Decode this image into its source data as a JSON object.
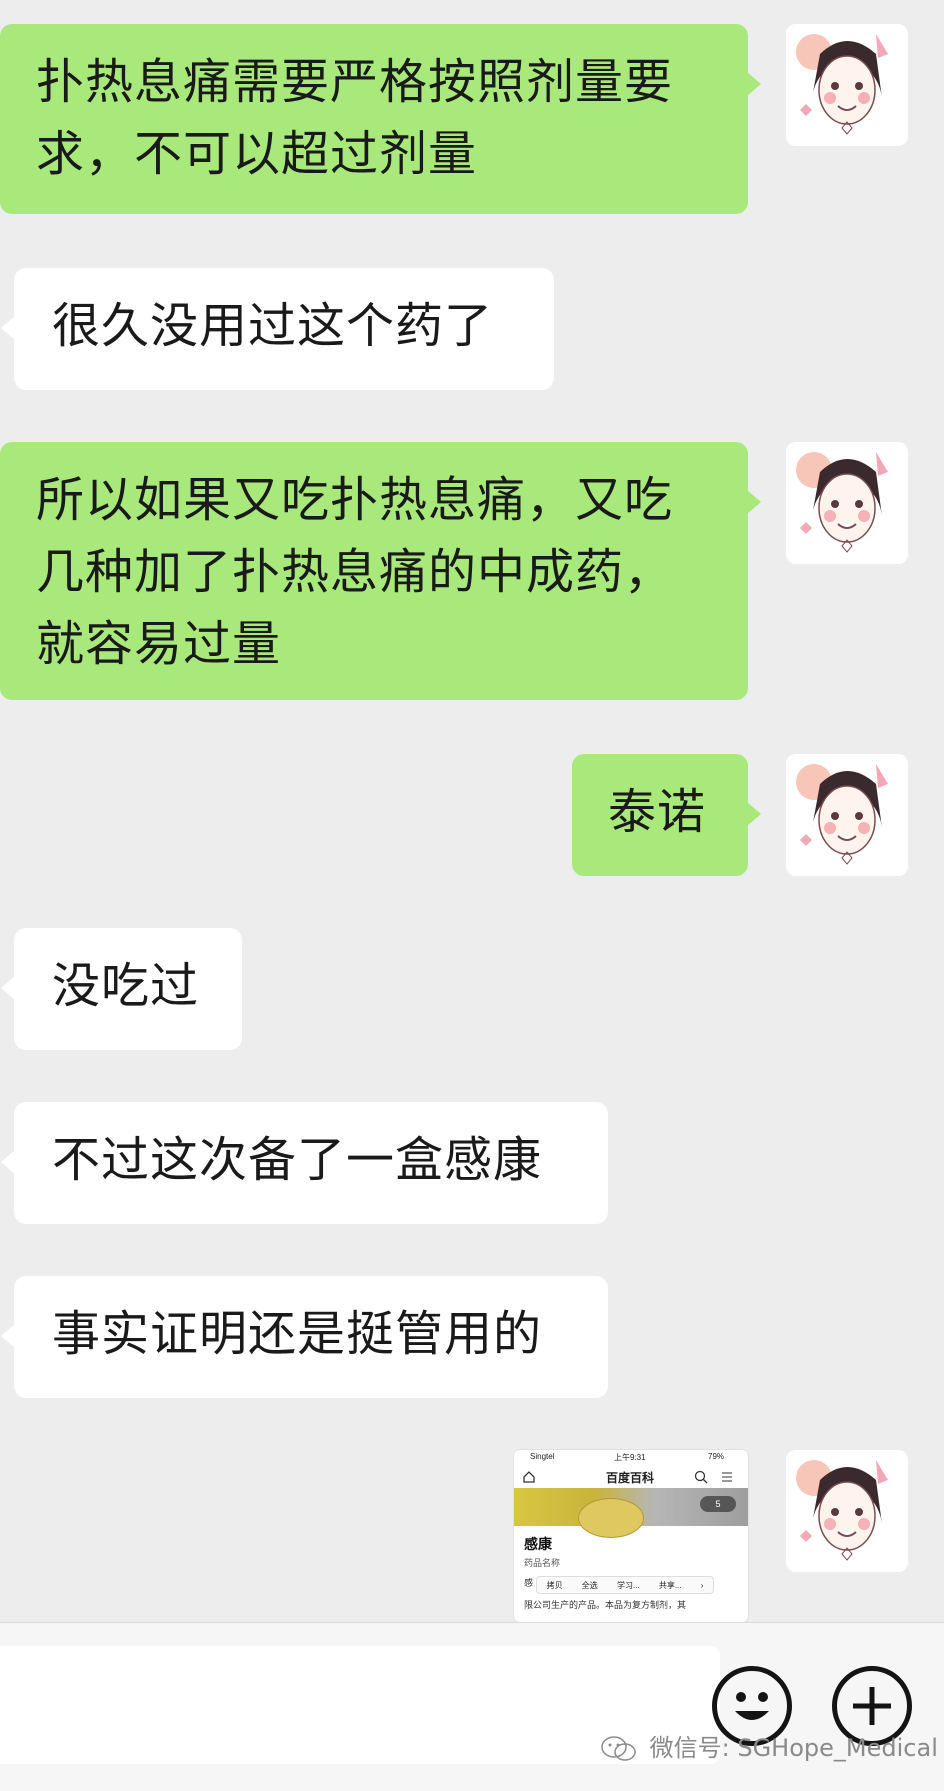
{
  "messages": [
    {
      "side": "out",
      "text": "扑热息痛需要严格按照剂量要求，不可以超过剂量"
    },
    {
      "side": "in",
      "text": "很久没用过这个药了"
    },
    {
      "side": "out",
      "text": "所以如果又吃扑热息痛，又吃几种加了扑热息痛的中成药，就容易过量"
    },
    {
      "side": "out",
      "text": "泰诺"
    },
    {
      "side": "in",
      "text": "没吃过"
    },
    {
      "side": "in",
      "text": "不过这次备了一盒感康"
    },
    {
      "side": "in",
      "text": "事实证明还是挺管用的"
    }
  ],
  "image_message": {
    "status_carrier": "Singtel",
    "status_time": "上午9:31",
    "status_battery": "79%",
    "app_title": "百度百科",
    "photo_count": "5",
    "entry_title": "感康",
    "entry_subtitle": "药品名称",
    "entry_body_prefix": "感",
    "entry_body_line2": "限公司生产的产品。本品为复方制剂，其",
    "context_menu": [
      "拷贝",
      "全选",
      "学习...",
      "共享..."
    ]
  },
  "input_bar": {
    "input_value": "",
    "emoji_button": "emoji",
    "plus_button": "more"
  },
  "watermark": "微信号: SGHope_Medical",
  "colors": {
    "background": "#ededed",
    "outgoing_bubble": "#a9e97b",
    "incoming_bubble": "#ffffff"
  }
}
